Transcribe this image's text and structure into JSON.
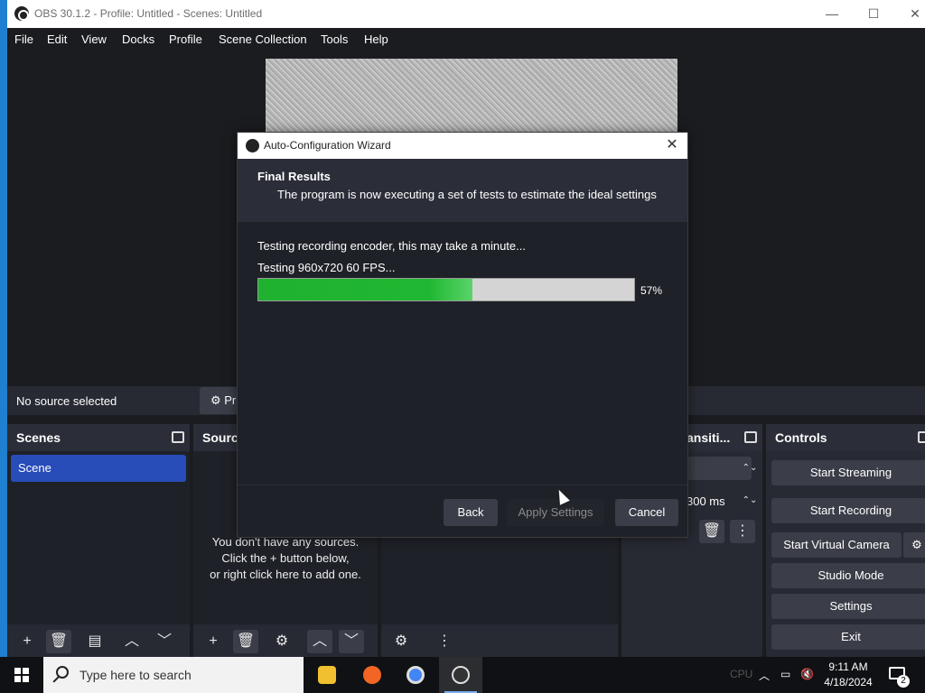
{
  "window": {
    "title": "OBS 30.1.2 - Profile: Untitled - Scenes: Untitled",
    "minimize": "—",
    "maximize": "☐",
    "close": "✕"
  },
  "menu": [
    "File",
    "Edit",
    "View",
    "Docks",
    "Profile",
    "Scene Collection",
    "Tools",
    "Help"
  ],
  "context_bar": {
    "no_source": "No source selected",
    "properties_label": "⚙ Pr"
  },
  "docks": {
    "scenes": {
      "title": "Scenes",
      "items": [
        "Scene"
      ]
    },
    "sources": {
      "title": "Sourc",
      "empty_lines": [
        "You don't have any sources.",
        "Click the + button below,",
        "or right click here to add one."
      ]
    },
    "transitions": {
      "title": "ansiti...",
      "duration": "300 ms"
    },
    "controls": {
      "title": "Controls",
      "buttons": [
        "Start Streaming",
        "Start Recording",
        "Start Virtual Camera",
        "Studio Mode",
        "Settings",
        "Exit"
      ]
    }
  },
  "dialog": {
    "title": "Auto-Configuration Wizard",
    "header_title": "Final Results",
    "header_subtitle": "The program is now executing a set of tests to estimate the ideal settings",
    "status_line": "Testing recording encoder, this may take a minute...",
    "detail_line": "Testing 960x720 60 FPS...",
    "progress_percent": 57,
    "progress_label": "57%",
    "buttons": {
      "back": "Back",
      "apply": "Apply Settings",
      "cancel": "Cancel"
    }
  },
  "taskbar": {
    "search_placeholder": "Type here to search",
    "time": "9:11 AM",
    "date": "4/18/2024",
    "notification_count": "2",
    "hidden_status": "CPU"
  },
  "icons": {
    "obs": "obs-logo-icon",
    "undock": "undock-icon",
    "add": "plus-icon",
    "remove": "trash-icon",
    "filter": "filter-icon",
    "up": "chevron-up-icon",
    "down": "chevron-down-icon",
    "gear": "gear-icon",
    "more": "more-vertical-icon"
  },
  "colors": {
    "accent": "#284cb8",
    "progress_fill": "#20b832",
    "panel": "#272a33",
    "background": "#1b1c20"
  }
}
